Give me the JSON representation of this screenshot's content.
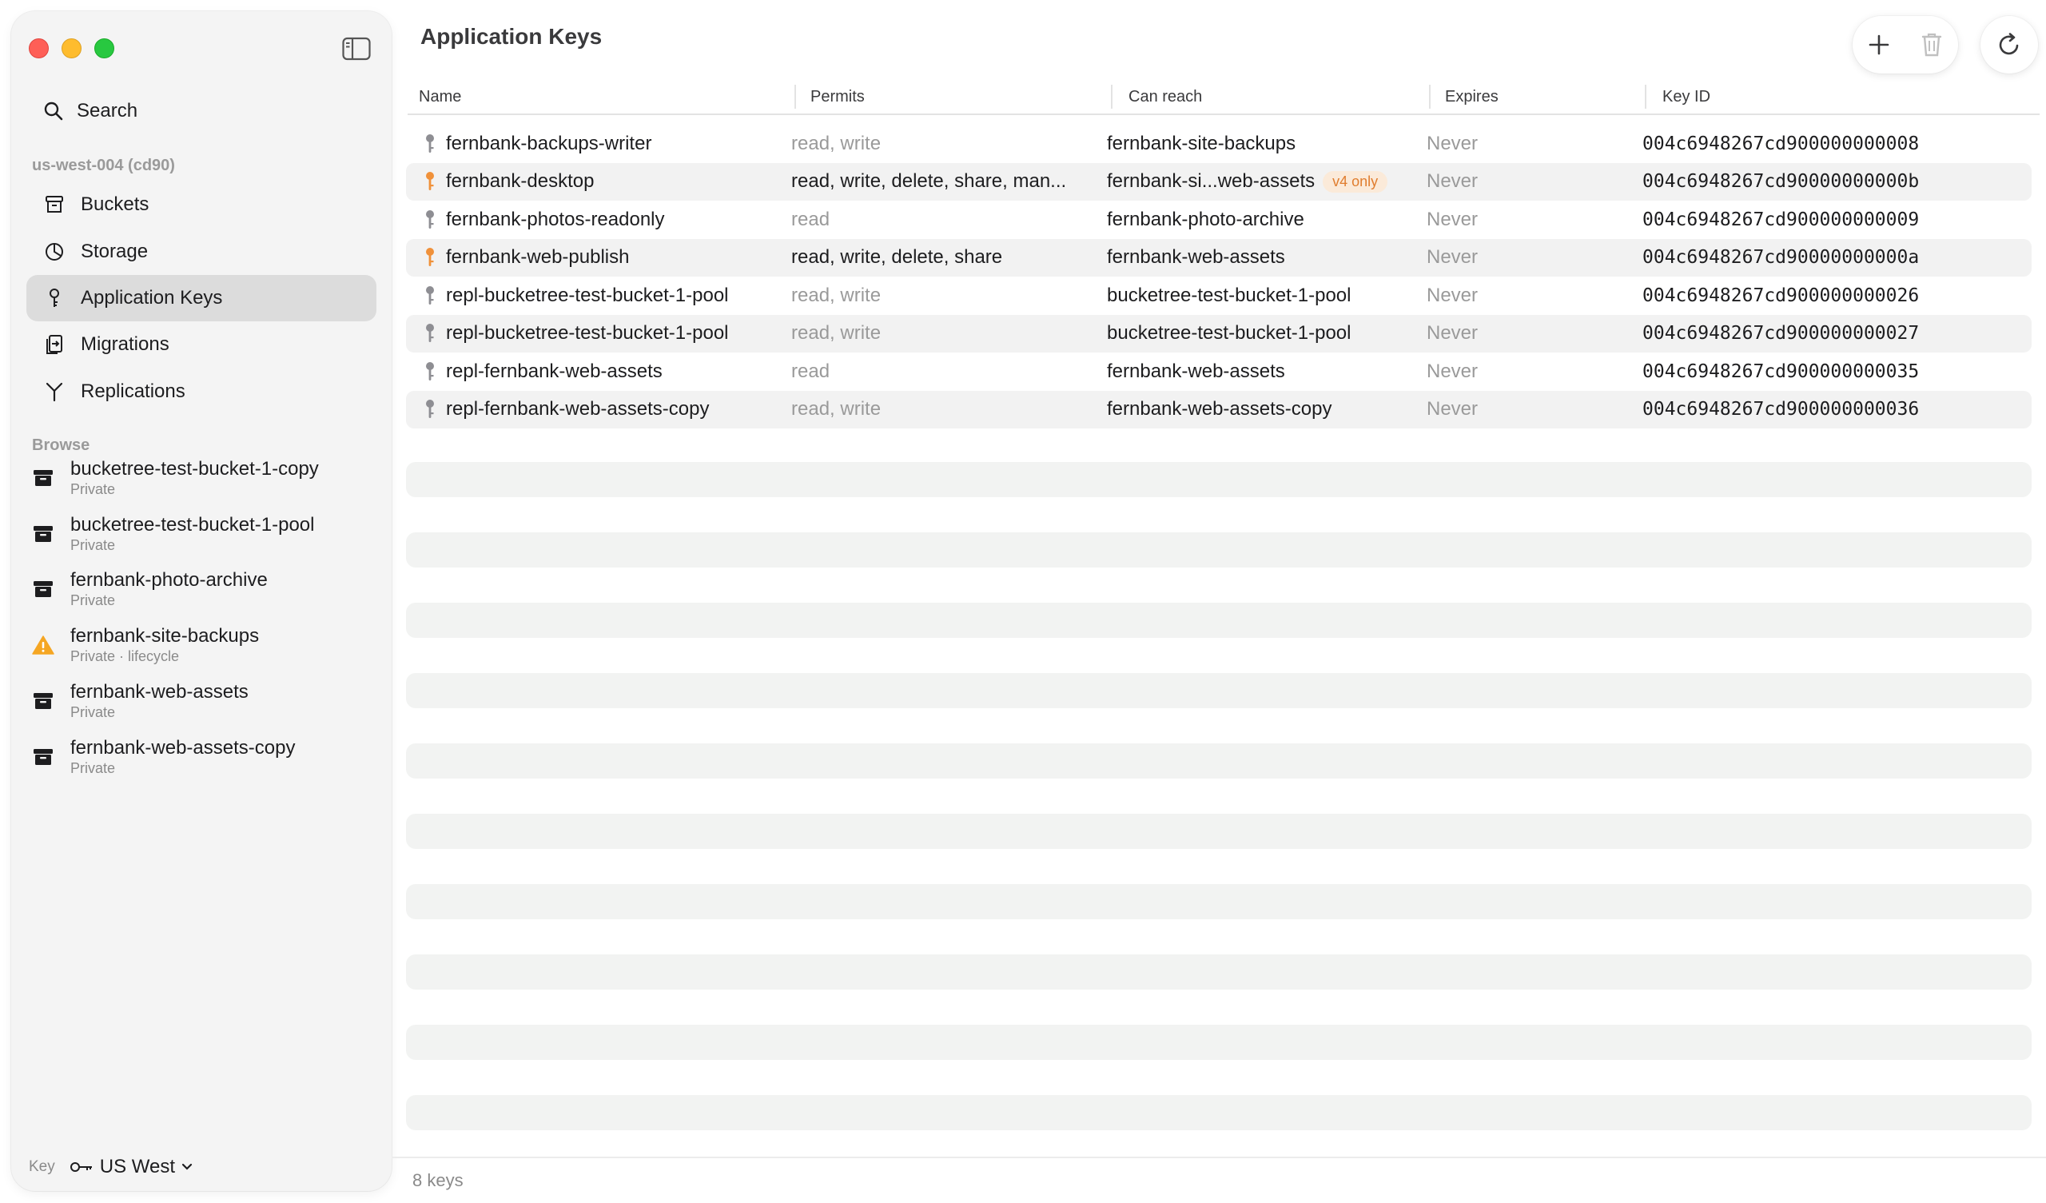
{
  "sidebar": {
    "search_label": "Search",
    "account_label": "us-west-004 (cd90)",
    "nav": [
      {
        "label": "Buckets",
        "icon": "bucket-icon",
        "active": false
      },
      {
        "label": "Storage",
        "icon": "chart-pie-icon",
        "active": false
      },
      {
        "label": "Application Keys",
        "icon": "key-icon",
        "active": true
      },
      {
        "label": "Migrations",
        "icon": "migration-icon",
        "active": false
      },
      {
        "label": "Replications",
        "icon": "fork-icon",
        "active": false
      }
    ],
    "browse_label": "Browse",
    "buckets": [
      {
        "name": "bucketree-test-bucket-1-copy",
        "sub": "Private",
        "icon": "archive-icon"
      },
      {
        "name": "bucketree-test-bucket-1-pool",
        "sub": "Private",
        "icon": "archive-icon"
      },
      {
        "name": "fernbank-photo-archive",
        "sub": "Private",
        "icon": "archive-icon"
      },
      {
        "name": "fernbank-site-backups",
        "sub": "Private · lifecycle",
        "icon": "warning-icon"
      },
      {
        "name": "fernbank-web-assets",
        "sub": "Private",
        "icon": "archive-icon"
      },
      {
        "name": "fernbank-web-assets-copy",
        "sub": "Private",
        "icon": "archive-icon"
      }
    ],
    "footer": {
      "label": "Key",
      "region": "US West"
    }
  },
  "main": {
    "title": "Application Keys",
    "columns": [
      "Name",
      "Permits",
      "Can reach",
      "Expires",
      "Key ID"
    ],
    "rows": [
      {
        "name": "fernbank-backups-writer",
        "permits": "read, write",
        "permits_strong": false,
        "reach": "fernbank-site-backups",
        "badge": "",
        "expires": "Never",
        "key_id": "004c6948267cd900000000008",
        "key_color": "gray"
      },
      {
        "name": "fernbank-desktop",
        "permits": "read, write, delete, share, man...",
        "permits_strong": true,
        "reach": "fernbank-si...web-assets",
        "badge": "v4 only",
        "expires": "Never",
        "key_id": "004c6948267cd90000000000b",
        "key_color": "orange"
      },
      {
        "name": "fernbank-photos-readonly",
        "permits": "read",
        "permits_strong": false,
        "reach": "fernbank-photo-archive",
        "badge": "",
        "expires": "Never",
        "key_id": "004c6948267cd900000000009",
        "key_color": "gray"
      },
      {
        "name": "fernbank-web-publish",
        "permits": "read, write, delete, share",
        "permits_strong": true,
        "reach": "fernbank-web-assets",
        "badge": "",
        "expires": "Never",
        "key_id": "004c6948267cd90000000000a",
        "key_color": "orange"
      },
      {
        "name": "repl-bucketree-test-bucket-1-pool",
        "permits": "read, write",
        "permits_strong": false,
        "reach": "bucketree-test-bucket-1-pool",
        "badge": "",
        "expires": "Never",
        "key_id": "004c6948267cd900000000026",
        "key_color": "gray"
      },
      {
        "name": "repl-bucketree-test-bucket-1-pool",
        "permits": "read, write",
        "permits_strong": false,
        "reach": "bucketree-test-bucket-1-pool",
        "badge": "",
        "expires": "Never",
        "key_id": "004c6948267cd900000000027",
        "key_color": "gray"
      },
      {
        "name": "repl-fernbank-web-assets",
        "permits": "read",
        "permits_strong": false,
        "reach": "fernbank-web-assets",
        "badge": "",
        "expires": "Never",
        "key_id": "004c6948267cd900000000035",
        "key_color": "gray"
      },
      {
        "name": "repl-fernbank-web-assets-copy",
        "permits": "read, write",
        "permits_strong": false,
        "reach": "fernbank-web-assets-copy",
        "badge": "",
        "expires": "Never",
        "key_id": "004c6948267cd900000000036",
        "key_color": "gray"
      }
    ],
    "status": "8 keys"
  },
  "colors": {
    "key_orange": "#f0913a",
    "key_gray": "#8e8e93",
    "warning_orange": "#f5a623",
    "accent_selected": "#dcdcdc"
  }
}
